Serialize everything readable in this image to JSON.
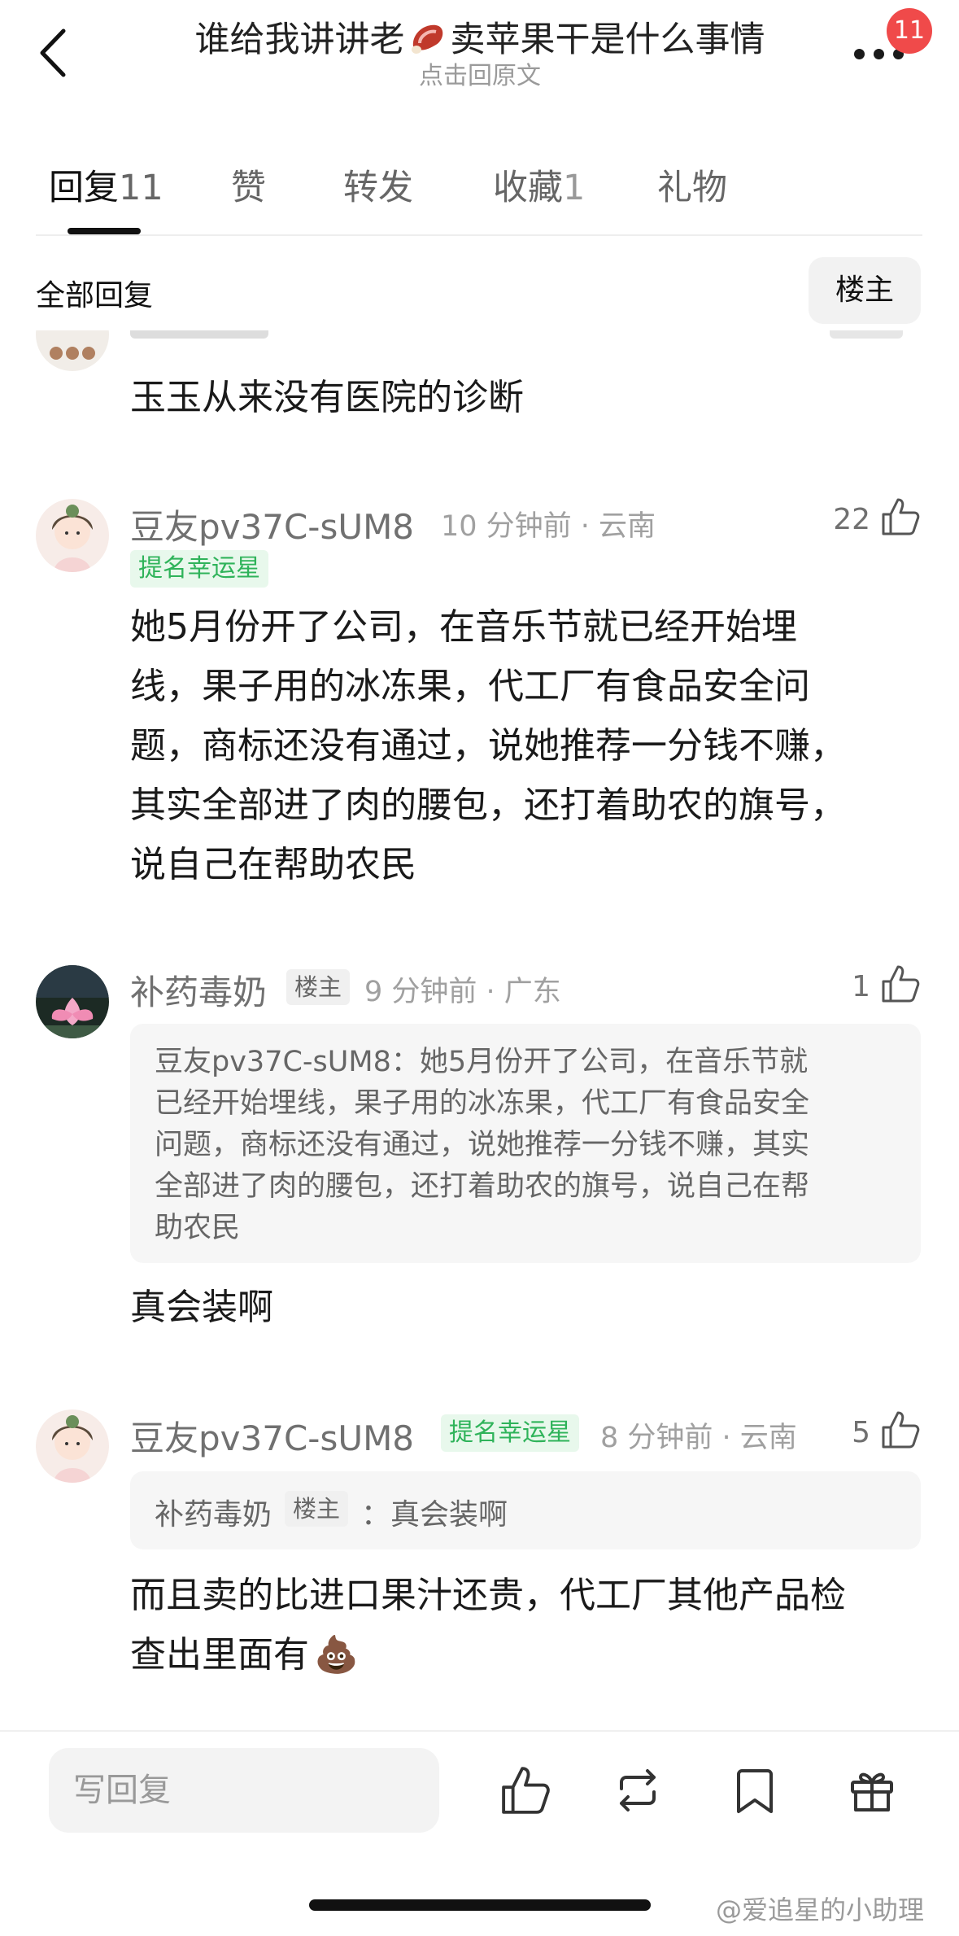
{
  "header": {
    "title_part1": "谁给我讲讲老",
    "title_part2": "卖苹果干是什么事情",
    "subtitle": "点击回原文",
    "notification_count": "11"
  },
  "tabs": [
    {
      "label": "回复",
      "count": "11",
      "active": true
    },
    {
      "label": "赞",
      "count": ""
    },
    {
      "label": "转发",
      "count": ""
    },
    {
      "label": "收藏",
      "count": "1"
    },
    {
      "label": "礼物",
      "count": ""
    }
  ],
  "filter": {
    "all_label": "全部回复",
    "op_label": "楼主"
  },
  "comments": [
    {
      "text": "玉玉从来没有医院的诊断"
    },
    {
      "username": "豆友pv37C-sUM8",
      "tag": "提名幸运星",
      "meta": "10 分钟前 · 云南",
      "likes": "22",
      "lines": [
        "她5月份开了公司，在音乐节就已经开始埋",
        "线，果子用的冰冻果，代工厂有食品安全问",
        "题，商标还没有通过，说她推荐一分钱不赚，",
        "其实全部进了肉的腰包，还打着助农的旗号，",
        "说自己在帮助农民"
      ]
    },
    {
      "username": "补药毒奶",
      "tag": "楼主",
      "meta": "9 分钟前 · 广东",
      "likes": "1",
      "quote_lines": [
        "豆友pv37C-sUM8：她5月份开了公司，在音乐节就",
        "已经开始埋线，果子用的冰冻果，代工厂有食品安全",
        "问题，商标还没有通过，说她推荐一分钱不赚，其实",
        "全部进了肉的腰包，还打着助农的旗号，说自己在帮",
        "助农民"
      ],
      "text": "真会装啊"
    },
    {
      "username": "豆友pv37C-sUM8",
      "tag": "提名幸运星",
      "meta": "8 分钟前 · 云南",
      "likes": "5",
      "quote_user": "补药毒奶",
      "quote_tag": "楼主",
      "quote_sep": "：",
      "quote_text": "真会装啊",
      "lines": [
        "而且卖的比进口果汁还贵，代工厂其他产品检",
        "查出里面有"
      ],
      "emoji": "💩"
    }
  ],
  "bottom": {
    "reply_placeholder": "写回复"
  },
  "watermark": "@爱追星的小助理"
}
